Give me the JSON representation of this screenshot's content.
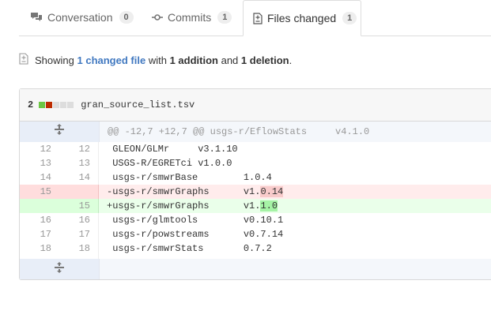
{
  "tabs": [
    {
      "label": "Conversation",
      "count": "0",
      "icon": "comment-discussion-icon"
    },
    {
      "label": "Commits",
      "count": "1",
      "icon": "git-commit-icon"
    },
    {
      "label": "Files changed",
      "count": "1",
      "icon": "file-diff-icon",
      "selected": true
    }
  ],
  "summary": {
    "prefix": "Showing",
    "changed_link": "1 changed file",
    "mid": "with",
    "additions": "1 addition",
    "and": "and",
    "deletions": "1 deletion",
    "end": "."
  },
  "file": {
    "changes": "2",
    "name": "gran_source_list.tsv",
    "diffstat": [
      "add",
      "del",
      "neutral",
      "neutral",
      "neutral"
    ],
    "hunk_header": "@@ -12,7 +12,7 @@ usgs-r/EflowStats     v4.1.0",
    "lines": [
      {
        "type": "ctx",
        "old": "12",
        "new": "12",
        "text": " GLEON/GLMr     v3.1.10"
      },
      {
        "type": "ctx",
        "old": "13",
        "new": "13",
        "text": " USGS-R/EGRETci v1.0.0"
      },
      {
        "type": "ctx",
        "old": "14",
        "new": "14",
        "text": " usgs-r/smwrBase        1.0.4"
      },
      {
        "type": "del",
        "old": "15",
        "new": "",
        "pre": "-usgs-r/smwrGraphs      v1.",
        "hl": "0.14",
        "post": ""
      },
      {
        "type": "add",
        "old": "",
        "new": "15",
        "pre": "+usgs-r/smwrGraphs      v1.",
        "hl": "1.0",
        "post": ""
      },
      {
        "type": "ctx",
        "old": "16",
        "new": "16",
        "text": " usgs-r/glmtools        v0.10.1"
      },
      {
        "type": "ctx",
        "old": "17",
        "new": "17",
        "text": " usgs-r/powstreams      v0.7.14"
      },
      {
        "type": "ctx",
        "old": "18",
        "new": "18",
        "text": " usgs-r/smwrStats       0.7.2"
      }
    ]
  },
  "colors": {
    "link": "#4078c0",
    "add": "#6cc644",
    "del": "#bd2c00"
  }
}
